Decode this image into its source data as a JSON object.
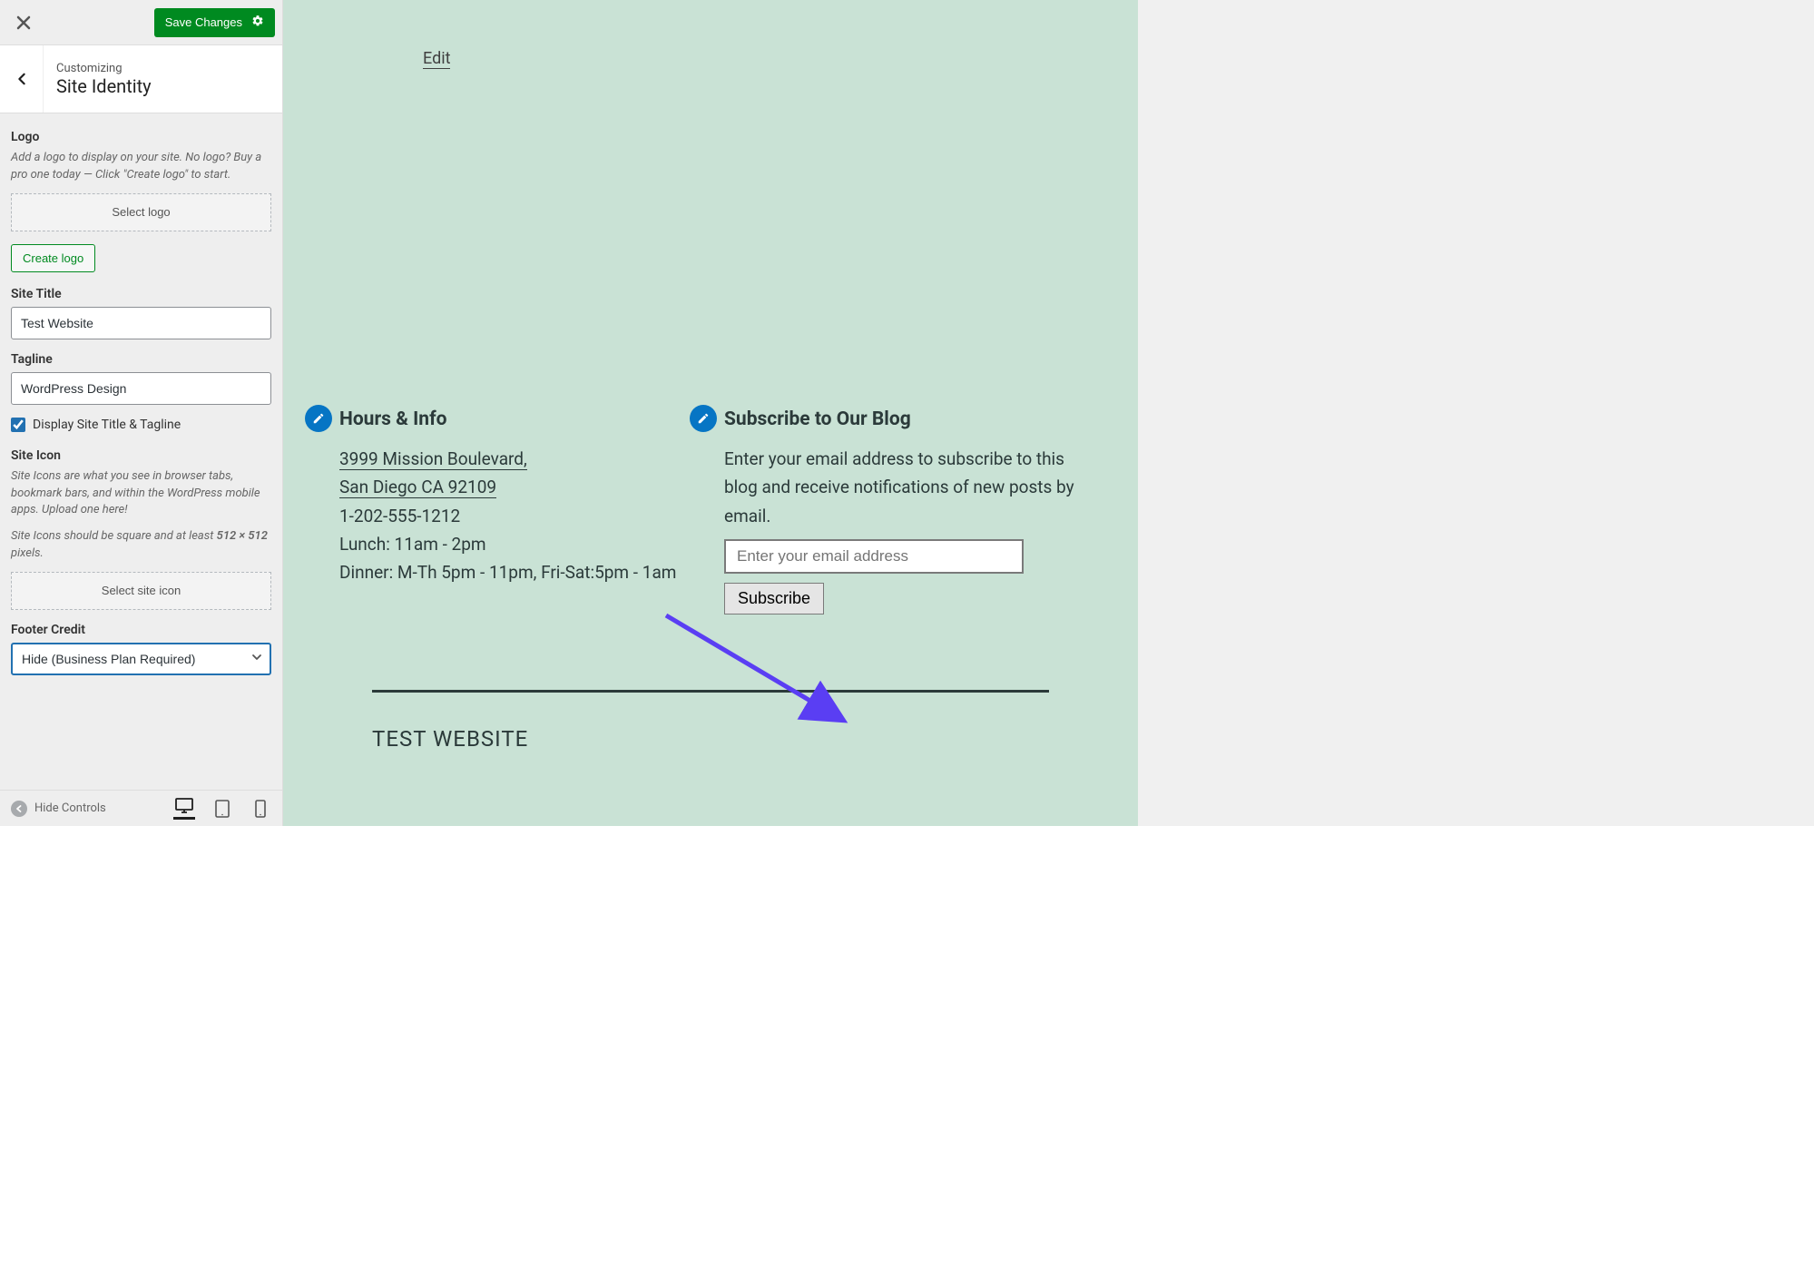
{
  "topbar": {
    "save_label": "Save Changes"
  },
  "header": {
    "customizing": "Customizing",
    "section": "Site Identity"
  },
  "panel": {
    "logo_heading": "Logo",
    "logo_desc": "Add a logo to display on your site. No logo? Buy a pro one today — Click \"Create logo\" to start.",
    "select_logo": "Select logo",
    "create_logo": "Create logo",
    "site_title_label": "Site Title",
    "site_title_value": "Test Website",
    "tagline_label": "Tagline",
    "tagline_value": "WordPress Design",
    "display_checkbox_label": "Display Site Title & Tagline",
    "display_checked": true,
    "site_icon_heading": "Site Icon",
    "site_icon_desc1": "Site Icons are what you see in browser tabs, bookmark bars, and within the WordPress mobile apps. Upload one here!",
    "site_icon_desc2_a": "Site Icons should be square and at least ",
    "site_icon_desc2_b": "512 × 512",
    "site_icon_desc2_c": " pixels.",
    "select_site_icon": "Select site icon",
    "footer_credit_label": "Footer Credit",
    "footer_credit_value": "Hide (Business Plan Required)"
  },
  "footerbar": {
    "hide_controls": "Hide Controls"
  },
  "preview": {
    "edit_link": "Edit",
    "hours_heading": "Hours & Info",
    "address_line1": "3999 Mission Boulevard,",
    "address_line2": "San Diego CA 92109",
    "phone": "1-202-555-1212",
    "lunch": "Lunch: 11am - 2pm",
    "dinner": "Dinner: M-Th 5pm - 11pm, Fri-Sat:5pm - 1am",
    "subscribe_heading": "Subscribe to Our Blog",
    "subscribe_desc": "Enter your email address to subscribe to this blog and receive notifications of new posts by email.",
    "email_placeholder": "Enter your email address",
    "subscribe_btn": "Subscribe",
    "footer_site_title": "TEST WEBSITE"
  }
}
